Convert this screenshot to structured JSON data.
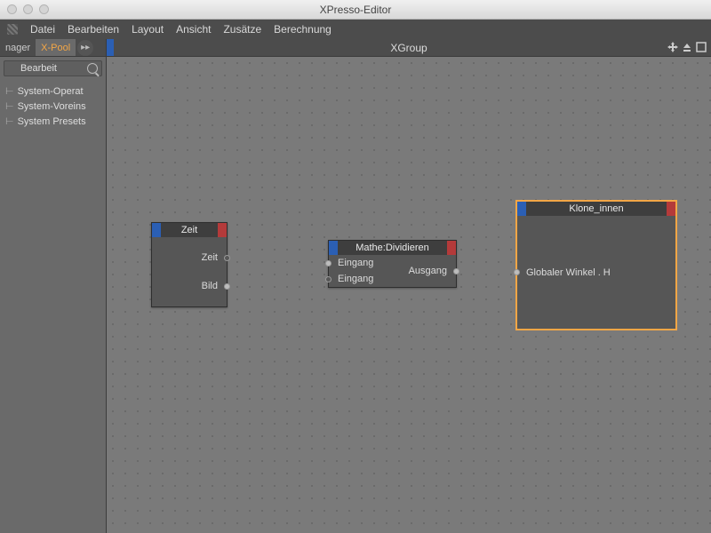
{
  "window": {
    "title": "XPresso-Editor"
  },
  "menu": {
    "items": [
      "Datei",
      "Bearbeiten",
      "Layout",
      "Ansicht",
      "Zusätze",
      "Berechnung"
    ]
  },
  "sidebar": {
    "tabs": {
      "left": "nager",
      "right": "X-Pool"
    },
    "category": "Bearbeit",
    "tree": [
      "System-Operat",
      "System-Voreins",
      "System Presets"
    ]
  },
  "canvas": {
    "title": "XGroup",
    "nodes": {
      "zeit": {
        "title": "Zeit",
        "outputs": [
          "Zeit",
          "Bild"
        ]
      },
      "mathe": {
        "title": "Mathe:Dividieren",
        "inputs": [
          "Eingang",
          "Eingang"
        ],
        "outputs": [
          "Ausgang"
        ]
      },
      "klone": {
        "title": "Klone_innen",
        "inputs": [
          "Globaler Winkel . H"
        ]
      }
    }
  }
}
